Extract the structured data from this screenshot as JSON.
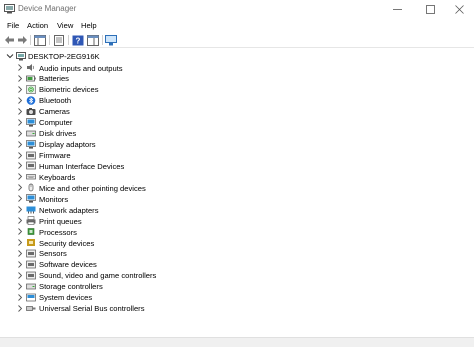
{
  "window": {
    "title": "Device Manager",
    "minimize": "—",
    "maximize": "☐",
    "close": "✕"
  },
  "menu": [
    "File",
    "Action",
    "View",
    "Help"
  ],
  "toolbar": [
    "back-arrow-icon",
    "forward-arrow-icon",
    "properties-icon",
    "show-hidden-icon",
    "help-icon",
    "update-driver-icon",
    "scan-hardware-icon"
  ],
  "tree": {
    "root": "DESKTOP-2EG916K",
    "items": [
      {
        "label": "Audio inputs and outputs",
        "icon": "speaker-icon",
        "color": "#6b6b6b"
      },
      {
        "label": "Batteries",
        "icon": "battery-icon",
        "color": "#3f9b3f"
      },
      {
        "label": "Biometric devices",
        "icon": "fingerprint-icon",
        "color": "#5a5a5a"
      },
      {
        "label": "Bluetooth",
        "icon": "bluetooth-icon",
        "color": "#1e6fd9"
      },
      {
        "label": "Cameras",
        "icon": "camera-icon",
        "color": "#4a4a4a"
      },
      {
        "label": "Computer",
        "icon": "computer-icon",
        "color": "#2d8fd8"
      },
      {
        "label": "Disk drives",
        "icon": "disk-drive-icon",
        "color": "#6b6b6b"
      },
      {
        "label": "Display adaptors",
        "icon": "display-adapter-icon",
        "color": "#2d8fd8"
      },
      {
        "label": "Firmware",
        "icon": "firmware-icon",
        "color": "#6b6b6b"
      },
      {
        "label": "Human Interface Devices",
        "icon": "hid-icon",
        "color": "#6b6b6b"
      },
      {
        "label": "Keyboards",
        "icon": "keyboard-icon",
        "color": "#6b6b6b"
      },
      {
        "label": "Mice and other pointing devices",
        "icon": "mouse-icon",
        "color": "#6b6b6b"
      },
      {
        "label": "Monitors",
        "icon": "monitor-icon",
        "color": "#2d8fd8"
      },
      {
        "label": "Network adapters",
        "icon": "network-adapter-icon",
        "color": "#2d8fd8"
      },
      {
        "label": "Print queues",
        "icon": "printer-icon",
        "color": "#6b6b6b"
      },
      {
        "label": "Processors",
        "icon": "processor-icon",
        "color": "#3f9b3f"
      },
      {
        "label": "Security devices",
        "icon": "security-device-icon",
        "color": "#c79a1a"
      },
      {
        "label": "Sensors",
        "icon": "sensor-icon",
        "color": "#6b6b6b"
      },
      {
        "label": "Software devices",
        "icon": "software-device-icon",
        "color": "#6b6b6b"
      },
      {
        "label": "Sound, video and game controllers",
        "icon": "sound-controller-icon",
        "color": "#6b6b6b"
      },
      {
        "label": "Storage controllers",
        "icon": "storage-controller-icon",
        "color": "#6b6b6b"
      },
      {
        "label": "System devices",
        "icon": "system-devices-icon",
        "color": "#2d8fd8"
      },
      {
        "label": "Universal Serial Bus controllers",
        "icon": "usb-icon",
        "color": "#6b6b6b"
      }
    ]
  }
}
